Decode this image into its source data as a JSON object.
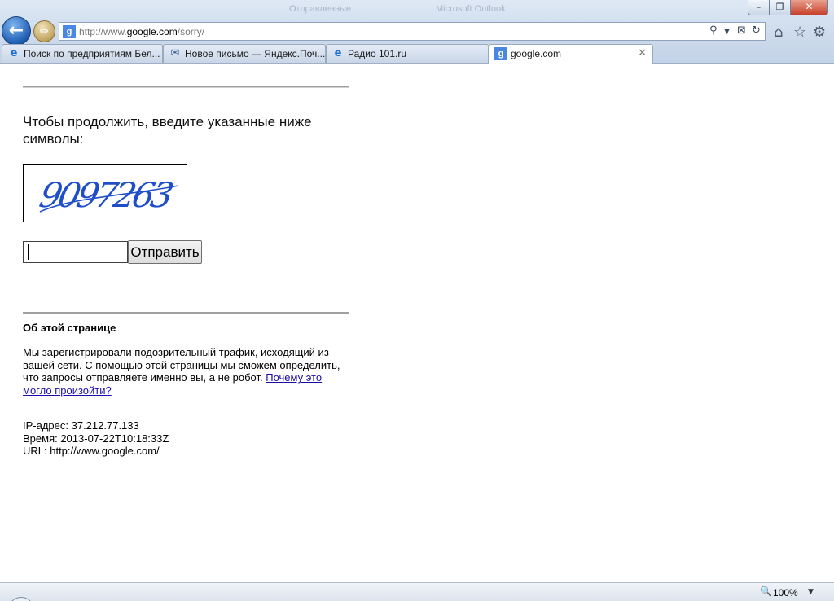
{
  "window": {
    "title_ghost": [
      "Отправленные",
      "Microsoft Outlook"
    ],
    "controls": {
      "minimize": "–",
      "maximize": "❐",
      "close": "✕"
    }
  },
  "nav": {
    "back_icon": "arrow-left-icon",
    "forward_icon": "arrow-right-icon",
    "back_glyph": "←",
    "forward_glyph": "⇨"
  },
  "address_bar": {
    "favicon": "g",
    "url_prefix": "http://www.",
    "url_domain": "google.com",
    "url_suffix": "/sorry/",
    "tool_glyphs": {
      "search": "⚲",
      "dropdown": "▼",
      "compat": "⊠",
      "refresh": "↻"
    }
  },
  "command_bar": {
    "home": "⌂",
    "favorites": "☆",
    "tools": "⚙"
  },
  "tabs": [
    {
      "label": "Поиск по предприятиям Бел...",
      "icon": "ie-icon",
      "glyph": "e",
      "active": false
    },
    {
      "label": "Новое письмо — Яндекс.Поч...",
      "icon": "mail-icon",
      "glyph": "✉",
      "active": false
    },
    {
      "label": "Радио 101.ru",
      "icon": "ie-icon",
      "glyph": "e",
      "active": false
    },
    {
      "label": "google.com",
      "icon": "google-favicon-icon",
      "glyph": "g",
      "active": true
    }
  ],
  "tab_close_glyph": "✕",
  "page": {
    "prompt": "Чтобы продолжить, введите указанные ниже символы:",
    "captcha_text": "9097263",
    "input_value": "",
    "submit_label": "Отправить",
    "about_title": "Об этой странице",
    "about_text": "Мы зарегистрировали подозрительный трафик, исходящий из вашей сети. С помощью этой страницы мы сможем определить, что запросы отправляете именно вы, а не робот.",
    "about_link": "Почему это могло произойти?",
    "ip_line": "IP-адрес: 37.212.77.133",
    "time_line": "Время: 2013-07-22T10:18:33Z",
    "url_line": "URL: http://www.google.com/"
  },
  "status_bar": {
    "zoom_glyph": "🔍",
    "zoom_level": "100%",
    "dropdown_glyph": "▼"
  },
  "colors": {
    "link": "#1a0dab",
    "captcha_ink": "#1f4fc8",
    "tab_accent": "#4a87e3"
  }
}
